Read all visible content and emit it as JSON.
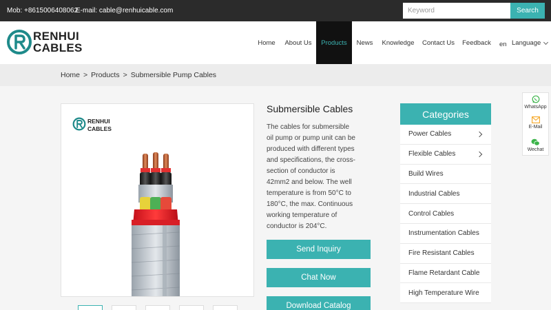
{
  "topbar": {
    "mobile": "Mob: +8615006408062",
    "email": "E-mail: cable@renhuicable.com",
    "search_placeholder": "Keyword",
    "search_button": "Search"
  },
  "header": {
    "logo_line1": "RENHUI",
    "logo_line2": "CABLES",
    "nav": [
      "Home",
      "About Us",
      "Products",
      "News",
      "Knowledge",
      "Contact Us",
      "Feedback"
    ],
    "active_nav": "Products",
    "lang_code": "en",
    "language_label": "Language"
  },
  "breadcrumb": {
    "home": "Home",
    "sep": ">",
    "products": "Products",
    "current": "Submersible Pump Cables"
  },
  "product": {
    "image_logo_line1": "RENHUI",
    "image_logo_line2": "CABLES",
    "title": "Submersible Cables",
    "description": "The cables for submersible oil pump or pump unit can be produced with different types and specifications, the cross-section of conductor is 42mm2 and below. The well temperature is from 50°C to 180°C, the max. Continuous working temperature of conductor is 204°C.",
    "buttons": [
      "Send Inquiry",
      "Chat Now",
      "Download Catalog"
    ]
  },
  "categories": {
    "title": "Categories",
    "items": [
      {
        "label": "Power Cables",
        "has_sub": true
      },
      {
        "label": "Flexible Cables",
        "has_sub": true
      },
      {
        "label": "Build Wires",
        "has_sub": false
      },
      {
        "label": "Industrial Cables",
        "has_sub": false
      },
      {
        "label": "Control Cables",
        "has_sub": false
      },
      {
        "label": "Instrumentation Cables",
        "has_sub": false
      },
      {
        "label": "Fire Resistant Cables",
        "has_sub": false
      },
      {
        "label": "Flame Retardant Cable",
        "has_sub": false
      },
      {
        "label": "High Temperature Wire",
        "has_sub": false
      }
    ]
  },
  "floating": {
    "whatsapp": "WhatsApp",
    "email": "E-Mail",
    "wechat": "Wechat"
  },
  "colors": {
    "accent": "#3bb2b1",
    "topbar": "#2b2b2b",
    "nav_active_bg": "#111111"
  }
}
